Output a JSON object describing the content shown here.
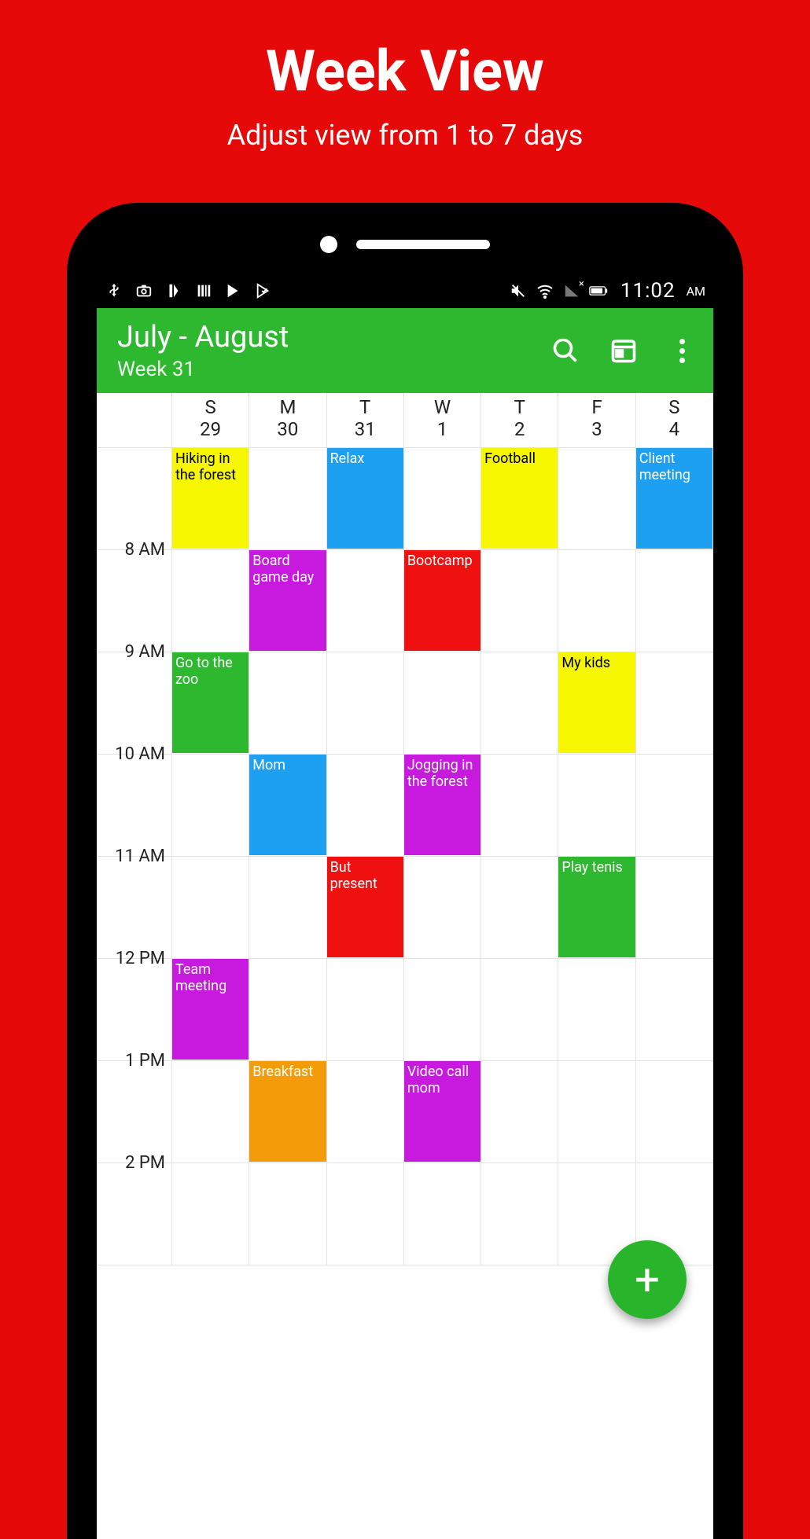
{
  "promo": {
    "title": "Week View",
    "subtitle": "Adjust view from 1 to 7 days"
  },
  "statusbar": {
    "time": "11:02",
    "ampm": "AM"
  },
  "toolbar": {
    "title": "July - August",
    "subtitle": "Week 31"
  },
  "days": [
    {
      "dow": "S",
      "num": "29"
    },
    {
      "dow": "M",
      "num": "30"
    },
    {
      "dow": "T",
      "num": "31"
    },
    {
      "dow": "W",
      "num": "1"
    },
    {
      "dow": "T",
      "num": "2"
    },
    {
      "dow": "F",
      "num": "3"
    },
    {
      "dow": "S",
      "num": "4"
    }
  ],
  "hours": [
    "8 AM",
    "9 AM",
    "10 AM",
    "11 AM",
    "12 PM",
    "1 PM",
    "2 PM"
  ],
  "colors": {
    "yellow": "#f6f700",
    "blue": "#1ea0f2",
    "magenta": "#c81adf",
    "red": "#ef1010",
    "green": "#2db82f",
    "orange": "#f49b0a"
  },
  "events": [
    {
      "day": 0,
      "startRow": 0,
      "span": 1,
      "label": "Hiking in the forest",
      "color": "yellow",
      "text": "#000"
    },
    {
      "day": 2,
      "startRow": 0,
      "span": 1,
      "label": "Relax",
      "color": "blue"
    },
    {
      "day": 4,
      "startRow": 0,
      "span": 1,
      "label": "Football",
      "color": "yellow",
      "text": "#000"
    },
    {
      "day": 6,
      "startRow": 0,
      "span": 1,
      "label": "Client meeting",
      "color": "blue"
    },
    {
      "day": 1,
      "startRow": 1,
      "span": 1,
      "label": "Board game day",
      "color": "magenta"
    },
    {
      "day": 3,
      "startRow": 1,
      "span": 1,
      "label": "Bootcamp",
      "color": "red"
    },
    {
      "day": 0,
      "startRow": 2,
      "span": 1,
      "label": "Go to the zoo",
      "color": "green"
    },
    {
      "day": 5,
      "startRow": 2,
      "span": 1,
      "label": "My kids",
      "color": "yellow",
      "text": "#000"
    },
    {
      "day": 1,
      "startRow": 3,
      "span": 1,
      "label": "Mom",
      "color": "blue"
    },
    {
      "day": 3,
      "startRow": 3,
      "span": 1,
      "label": "Jogging in the forest",
      "color": "magenta"
    },
    {
      "day": 2,
      "startRow": 4,
      "span": 1,
      "label": "But present",
      "color": "red"
    },
    {
      "day": 5,
      "startRow": 4,
      "span": 1,
      "label": "Play tenis",
      "color": "green"
    },
    {
      "day": 0,
      "startRow": 5,
      "span": 1,
      "label": "Team meeting",
      "color": "magenta"
    },
    {
      "day": 1,
      "startRow": 6,
      "span": 1,
      "label": "Breakfast",
      "color": "orange"
    },
    {
      "day": 3,
      "startRow": 6,
      "span": 1,
      "label": "Video call mom",
      "color": "magenta"
    }
  ],
  "fab": {
    "label": "+"
  }
}
